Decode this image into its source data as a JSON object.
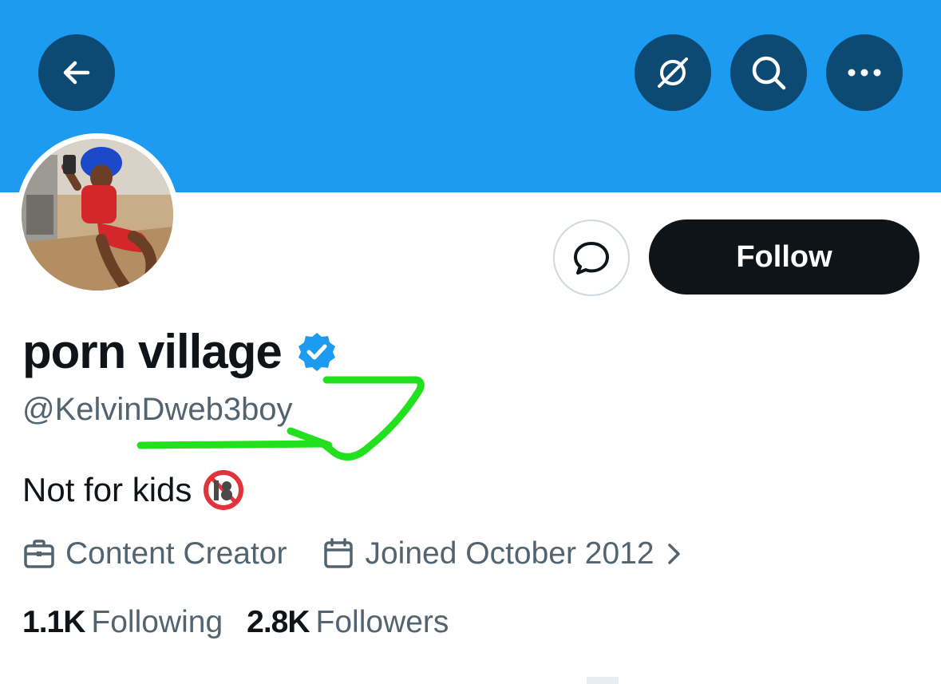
{
  "profile": {
    "display_name": "porn village",
    "handle": "@KelvinDweb3boy",
    "bio": "Not for kids",
    "bio_emoji": "no-one-under-eighteen-icon",
    "profession": "Content Creator",
    "joined": "Joined October 2012",
    "following_count": "1.1K",
    "following_label": "Following",
    "followers_count": "2.8K",
    "followers_label": "Followers",
    "verified": true
  },
  "header": {
    "back_icon": "arrow-left-icon",
    "grok_icon": "grok-icon",
    "search_icon": "search-icon",
    "more_icon": "more-horizontal-icon"
  },
  "actions": {
    "message_icon": "message-bubble-icon",
    "follow_label": "Follow"
  },
  "colors": {
    "banner": "#1d9bf0",
    "header_button": "#0d4a73",
    "verified": "#1d9bf0",
    "follow_button": "#0f1419",
    "secondary_text": "#536471",
    "annotation_stroke": "#22e01e"
  }
}
